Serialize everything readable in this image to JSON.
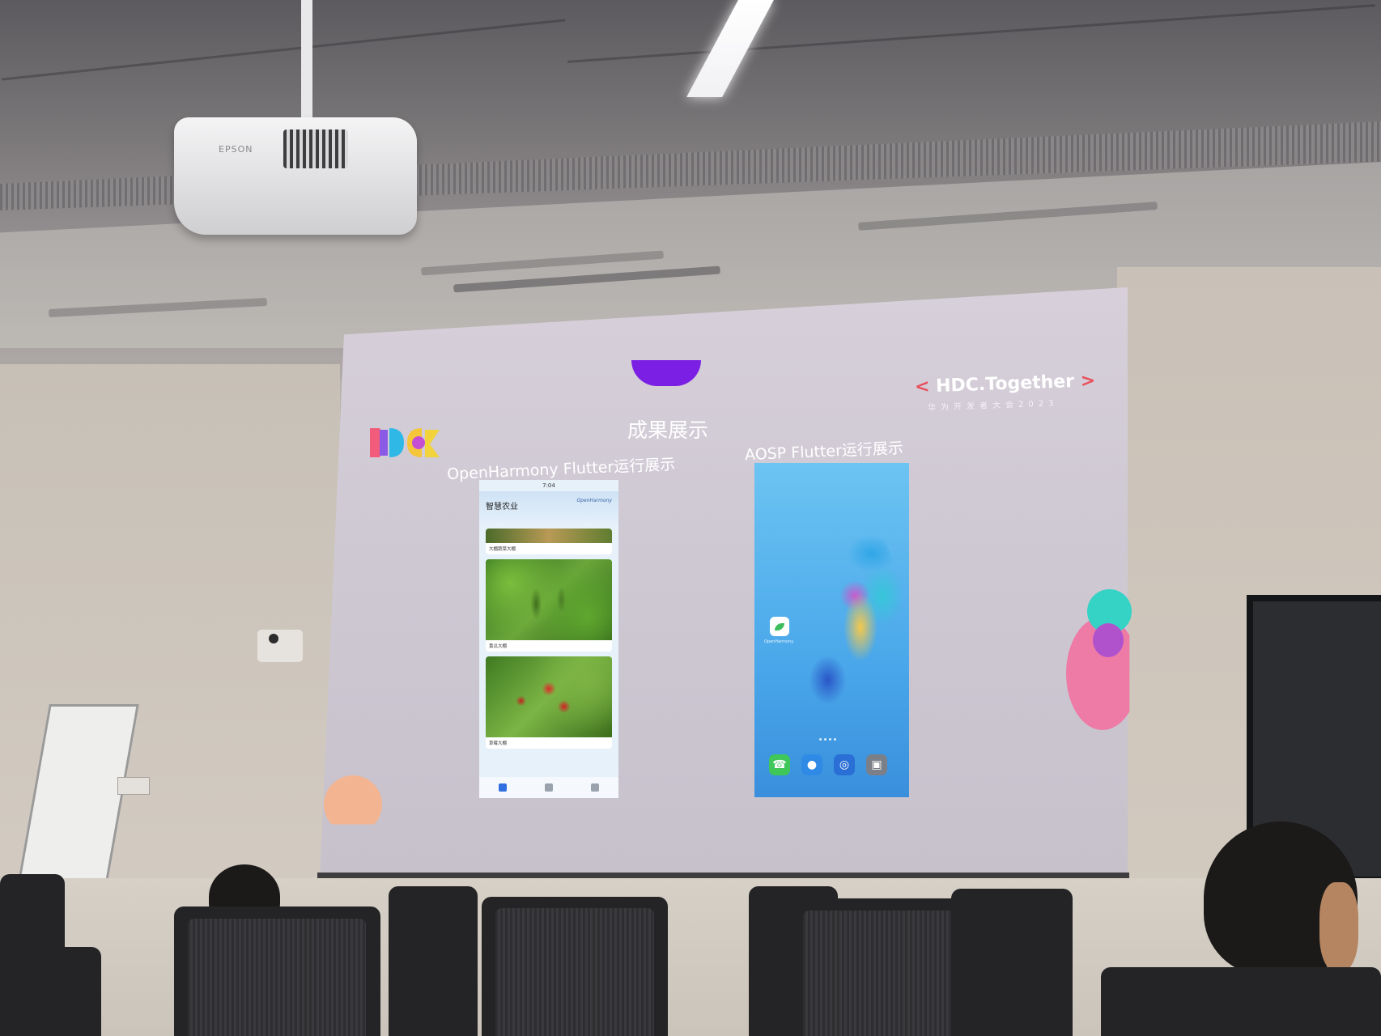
{
  "slide": {
    "title": "成果展示",
    "brand_title_left": "<",
    "brand_title_main": "HDC.Together",
    "brand_title_right": ">",
    "brand_subtitle": "华为开发者大会2023",
    "label_left": "OpenHarmony Flutter运行展示",
    "label_right": "AOSP Flutter运行展示"
  },
  "phone_left": {
    "status": "7:04",
    "app_title": "智慧农业",
    "logo_text": "OpenHarmony",
    "cards": [
      {
        "caption": "大棚蔬菜大棚",
        "meta": ""
      },
      {
        "caption": "黄瓜大棚",
        "meta": ""
      },
      {
        "caption": "草莓大棚",
        "meta": ""
      }
    ]
  },
  "phone_right": {
    "app_label": "OpenHarmony"
  },
  "projector": {
    "brand": "EPSON"
  },
  "colors": {
    "accent_purple": "#7b1fe4",
    "peach": "#f3b591",
    "teal": "#35d2c6",
    "pink": "#ee7aa6",
    "bracket_red": "#e8505b"
  },
  "icons": {
    "dock": [
      "phone-icon",
      "message-icon",
      "browser-icon",
      "camera-icon"
    ],
    "navbar": [
      "home-icon",
      "list-icon",
      "profile-icon"
    ]
  }
}
